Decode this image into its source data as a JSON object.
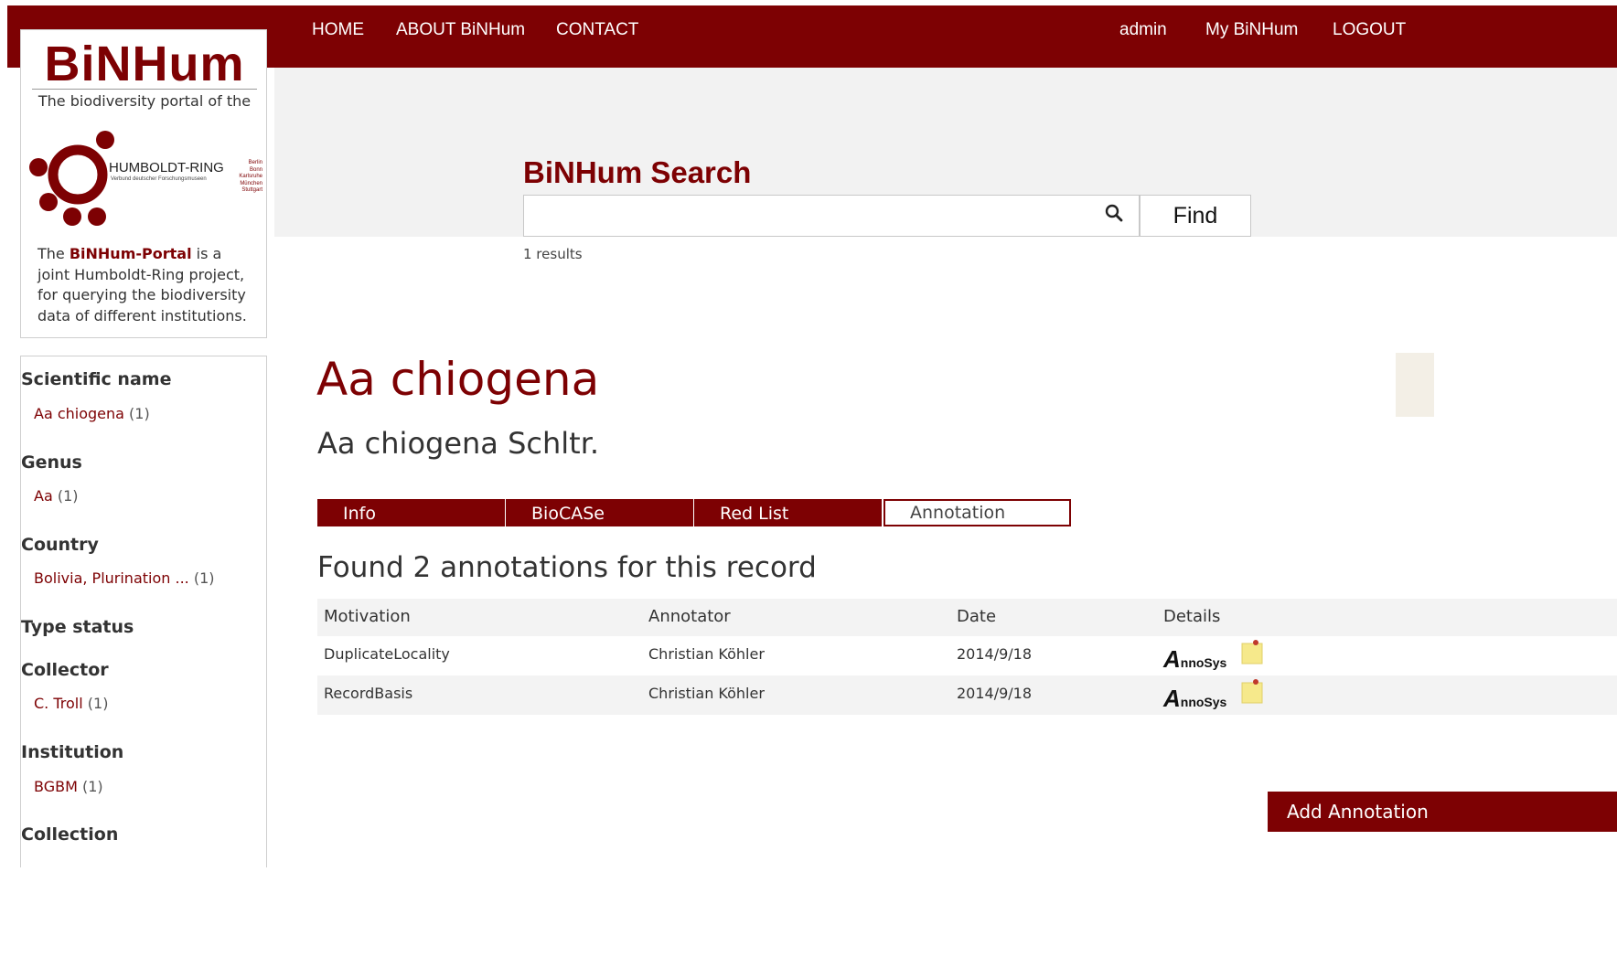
{
  "nav": {
    "home": "HOME",
    "about": "ABOUT BiNHum",
    "contact": "CONTACT",
    "user": "admin",
    "my": "My BiNHum",
    "logout": "LOGOUT"
  },
  "logo": {
    "brand": "BiNHum",
    "tagline": "The biodiversity portal of the",
    "ring_name": "HUMBOLDT-RING",
    "ring_sub": "Verbund deutscher Forschungsmuseen",
    "ring_cities": [
      "Berlin",
      "Bonn",
      "Karlsruhe",
      "München",
      "Stuttgart"
    ],
    "desc_prefix": "The ",
    "desc_brand": "BiNHum-Portal",
    "desc_suffix": " is a joint Humboldt-Ring project, for querying the biodiversity data of different institutions."
  },
  "facets": [
    {
      "title": "Scientific name",
      "value": "Aa chiogena",
      "count": "(1)"
    },
    {
      "title": "Genus",
      "value": "Aa",
      "count": "(1)"
    },
    {
      "title": "Country",
      "value": "Bolivia, Plurination ...",
      "count": "(1)"
    },
    {
      "title": "Type status"
    },
    {
      "title": "Collector",
      "value": "C. Troll",
      "count": "(1)"
    },
    {
      "title": "Institution",
      "value": "BGBM",
      "count": "(1)"
    },
    {
      "title": "Collection"
    }
  ],
  "search": {
    "title": "BiNHum Search",
    "value": "",
    "find_label": "Find",
    "results": "1 results"
  },
  "record": {
    "title": "Aa chiogena",
    "subtitle": "Aa chiogena Schltr.",
    "tabs": [
      "Info",
      "BioCASe",
      "Red List",
      "Annotation"
    ],
    "active_tab": "Annotation",
    "found": "Found 2 annotations for this record"
  },
  "table": {
    "headers": [
      "Motivation",
      "Annotator",
      "Date",
      "Details"
    ],
    "rows": [
      {
        "motivation": "DuplicateLocality",
        "annotator": "Christian Köhler",
        "date": "2014/9/18"
      },
      {
        "motivation": "RecordBasis",
        "annotator": "Christian Köhler",
        "date": "2014/9/18"
      }
    ],
    "annosys": {
      "big": "A",
      "rest": "nnoSys"
    }
  },
  "add_annotation": "Add Annotation",
  "colors": {
    "brand": "#7d0103",
    "gray_band": "#f2f2f2"
  }
}
